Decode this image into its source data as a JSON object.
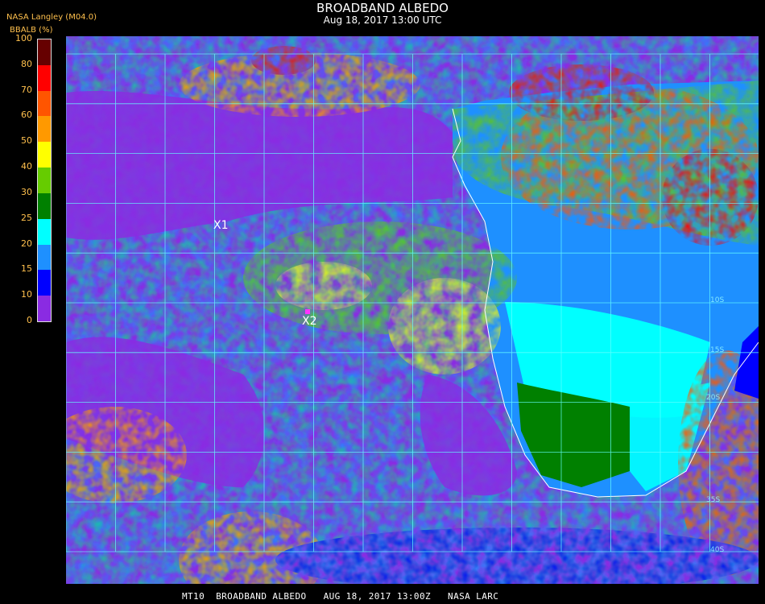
{
  "header": {
    "title": "BROADBAND ALBEDO",
    "subtitle": "Aug 18, 2017 13:00 UTC",
    "credit": "NASA Langley (M04.0)",
    "unit_label": "BBALB (%)"
  },
  "colorbar": {
    "ticks": [
      "100",
      "80",
      "70",
      "60",
      "50",
      "40",
      "30",
      "25",
      "20",
      "15",
      "10",
      "0"
    ],
    "bins": [
      {
        "label": "0-10",
        "color": "#8a2be2"
      },
      {
        "label": "10-15",
        "color": "#0000ff"
      },
      {
        "label": "15-20",
        "color": "#1e90ff"
      },
      {
        "label": "20-25",
        "color": "#00ffff"
      },
      {
        "label": "25-30",
        "color": "#008000"
      },
      {
        "label": "30-40",
        "color": "#66cc00"
      },
      {
        "label": "40-50",
        "color": "#ffff00"
      },
      {
        "label": "50-60",
        "color": "#ff9900"
      },
      {
        "label": "60-70",
        "color": "#ff5500"
      },
      {
        "label": "70-80",
        "color": "#ff0000"
      },
      {
        "label": "80-100",
        "color": "#660000"
      }
    ]
  },
  "map": {
    "markers": [
      {
        "label": "X1"
      },
      {
        "label": "X2"
      }
    ],
    "grid_color": "#66ffff",
    "coast_color": "#ffffff",
    "lat_labels": [
      "10S",
      "15S",
      "20S",
      "35S",
      "40S"
    ]
  },
  "footer": {
    "text": "MT10  BROADBAND ALBEDO   AUG 18, 2017 13:00Z   NASA LARC"
  }
}
